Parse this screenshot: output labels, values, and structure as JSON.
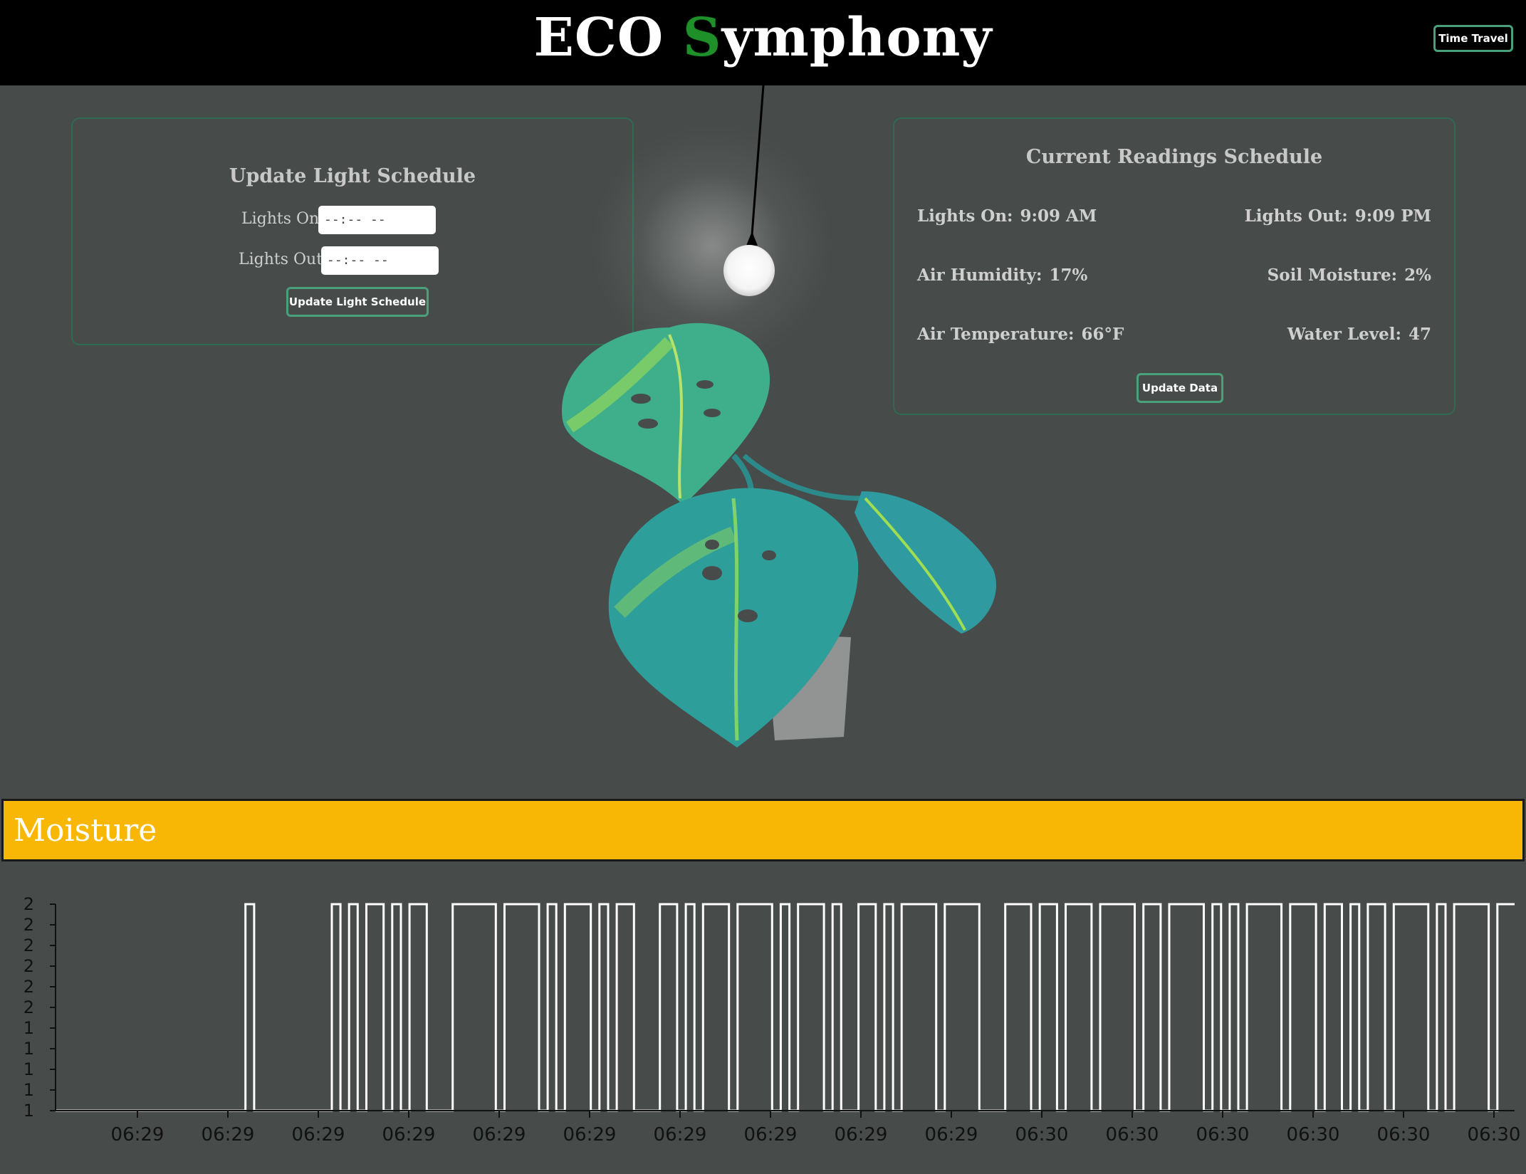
{
  "header": {
    "logo_prefix": "ECO ",
    "logo_s": "S",
    "logo_suffix": "ymphony",
    "time_travel_label": "Time Travel"
  },
  "light_schedule": {
    "title": "Update Light Schedule",
    "lights_on_label": "Lights On:",
    "lights_on_value": "--:-- --",
    "lights_out_label": "Lights Out:",
    "lights_out_value": "--:-- --",
    "button_label": "Update Light Schedule"
  },
  "readings": {
    "title": "Current Readings Schedule",
    "lights_on_label": "Lights On:",
    "lights_on_value": "9:09 AM",
    "lights_out_label": "Lights Out:",
    "lights_out_value": "9:09 PM",
    "air_humidity_label": "Air Humidity:",
    "air_humidity_value": "17%",
    "soil_moisture_label": "Soil Moisture:",
    "soil_moisture_value": "2%",
    "air_temp_label": "Air Temperature:",
    "air_temp_value": "66°F",
    "water_level_label": "Water Level:",
    "water_level_value": "47",
    "button_label": "Update Data"
  },
  "moisture": {
    "title": "Moisture"
  },
  "colors": {
    "background": "#474b4a",
    "accent": "#4aa07a",
    "moisture_banner": "#f8b705",
    "logo_s": "#1f8f2a"
  },
  "chart_data": {
    "type": "line",
    "title": "",
    "xlabel": "",
    "ylabel": "",
    "y_tick_labels": [
      "1",
      "1",
      "1",
      "1",
      "1",
      "2",
      "2",
      "2",
      "2",
      "2",
      "2"
    ],
    "x_tick_labels": [
      "06:29",
      "06:29",
      "06:29",
      "06:29",
      "06:29",
      "06:29",
      "06:29",
      "06:29",
      "06:29",
      "06:29",
      "06:30",
      "06:30",
      "06:30",
      "06:30",
      "06:30",
      "06:30"
    ],
    "ylim": [
      1,
      2
    ],
    "series": [
      {
        "values": [
          1,
          1,
          1,
          1,
          1,
          1,
          1,
          1,
          1,
          1,
          1,
          1,
          1,
          1,
          1,
          1,
          1,
          1,
          1,
          1,
          1,
          1,
          2,
          1,
          1,
          1,
          1,
          1,
          1,
          1,
          1,
          1,
          2,
          1,
          2,
          1,
          2,
          2,
          1,
          2,
          1,
          2,
          2,
          1,
          1,
          1,
          2,
          2,
          2,
          2,
          2,
          1,
          2,
          2,
          2,
          2,
          1,
          2,
          1,
          2,
          2,
          2,
          1,
          2,
          1,
          2,
          2,
          1,
          1,
          1,
          2,
          2,
          1,
          2,
          1,
          2,
          2,
          2,
          1,
          2,
          2,
          2,
          2,
          1,
          2,
          1,
          2,
          2,
          2,
          1,
          2,
          1,
          1,
          2,
          2,
          1,
          2,
          1,
          2,
          2,
          2,
          2,
          1,
          2,
          2,
          2,
          2,
          1,
          1,
          1,
          2,
          2,
          2,
          1,
          2,
          2,
          1,
          2,
          2,
          2,
          1,
          2,
          2,
          2,
          2,
          1,
          2,
          2,
          1,
          2,
          2,
          2,
          2,
          1,
          2,
          1,
          2,
          1,
          2,
          2,
          2,
          2,
          1,
          2,
          2,
          2,
          1,
          2,
          2,
          1,
          2,
          1,
          2,
          2,
          1,
          2,
          2,
          2,
          2,
          1,
          2,
          1,
          2,
          2,
          2,
          2,
          1,
          2,
          2
        ]
      }
    ]
  }
}
